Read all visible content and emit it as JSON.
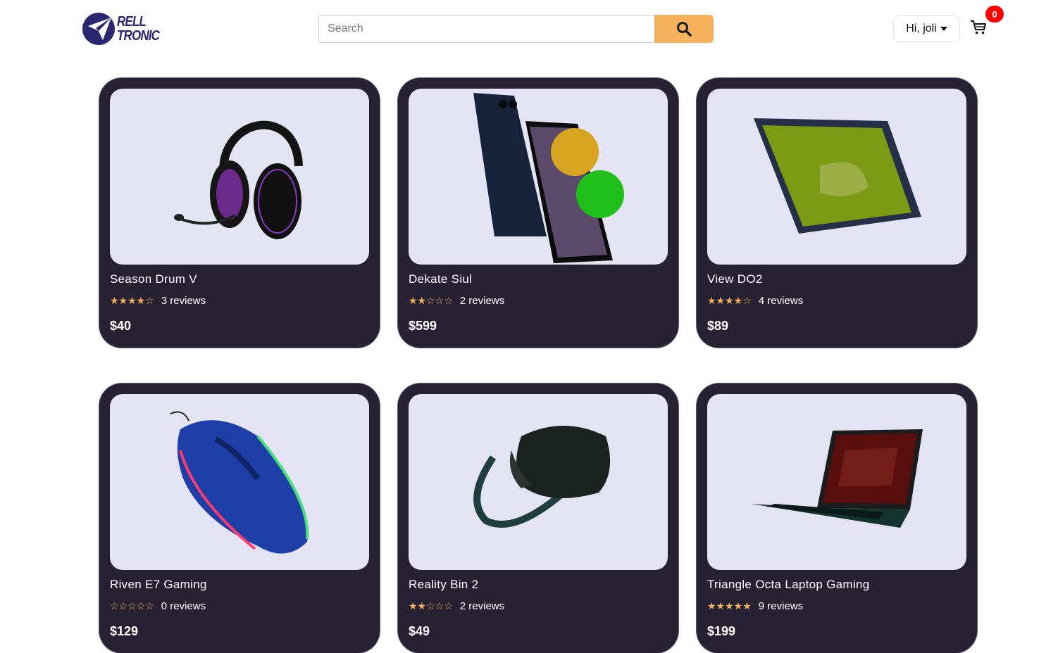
{
  "header": {
    "logo_line1": "RELL",
    "logo_line2": "TRONIC",
    "search_placeholder": "Search",
    "user_greeting": "Hi, joli",
    "cart_count": "0",
    "accent": "#f6b15c"
  },
  "products": [
    {
      "name": "Season Drum V",
      "stars": "★★★★☆",
      "reviews": "3 reviews",
      "price": "$40",
      "rating": 3.5
    },
    {
      "name": "Dekate Siul",
      "stars": "★★☆☆☆",
      "reviews": "2 reviews",
      "price": "$599",
      "rating": 2.5
    },
    {
      "name": "View DO2",
      "stars": "★★★★☆",
      "reviews": "4 reviews",
      "price": "$89",
      "rating": 4.5
    },
    {
      "name": "Riven E7 Gaming",
      "stars": "☆☆☆☆☆",
      "reviews": "0 reviews",
      "price": "$129",
      "rating": 0
    },
    {
      "name": "Reality Bin 2",
      "stars": "★★☆☆☆",
      "reviews": "2 reviews",
      "price": "$49",
      "rating": 2.5
    },
    {
      "name": "Triangle Octa Laptop Gaming",
      "stars": "★★★★★",
      "reviews": "9 reviews",
      "price": "$199",
      "rating": 5
    }
  ],
  "colors": {
    "card_bg": "#262233",
    "image_bg": "#e3e3f3",
    "star": "#f6b15c",
    "badge": "#ff0000"
  }
}
